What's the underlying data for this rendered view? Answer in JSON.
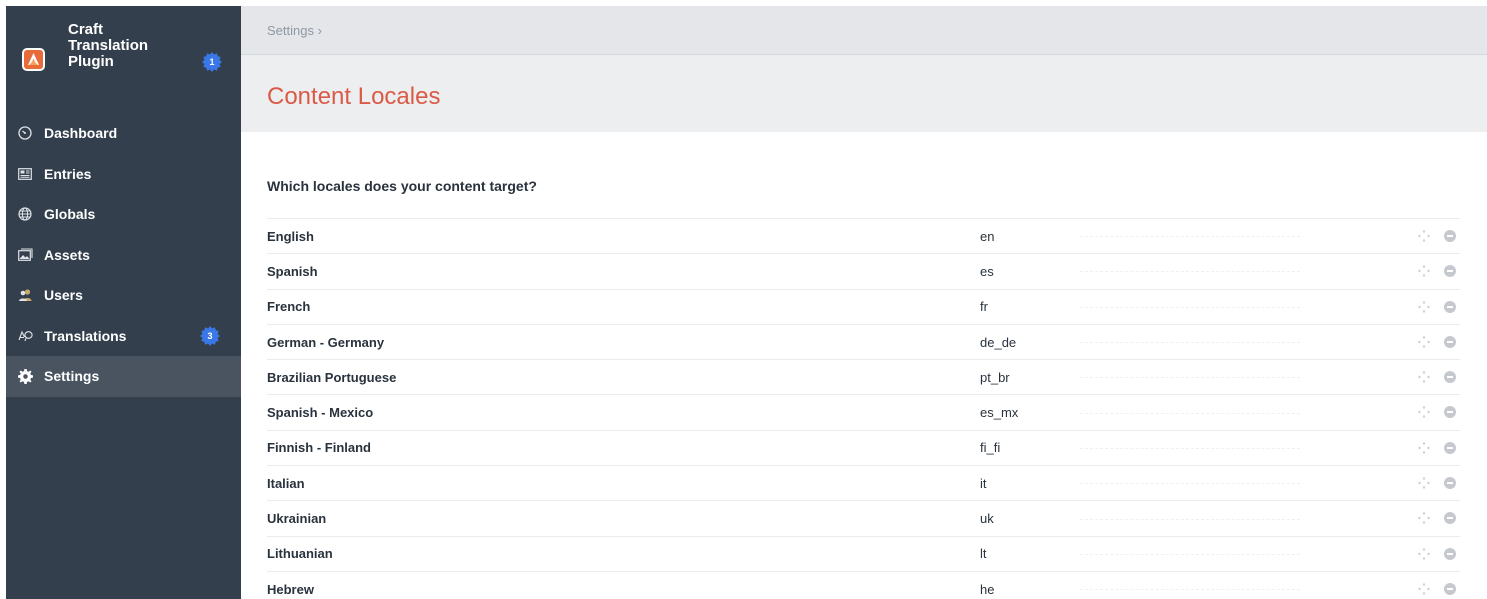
{
  "site": {
    "name": "Craft Translation Plugin",
    "badge": "1"
  },
  "nav": [
    {
      "label": "Dashboard",
      "icon": "gauge-icon",
      "badge": null,
      "active": false
    },
    {
      "label": "Entries",
      "icon": "newspaper-icon",
      "badge": null,
      "active": false
    },
    {
      "label": "Globals",
      "icon": "globe-icon",
      "badge": null,
      "active": false
    },
    {
      "label": "Assets",
      "icon": "photos-icon",
      "badge": null,
      "active": false
    },
    {
      "label": "Users",
      "icon": "users-icon",
      "badge": null,
      "active": false
    },
    {
      "label": "Translations",
      "icon": "translate-icon",
      "badge": "3",
      "active": false
    },
    {
      "label": "Settings",
      "icon": "gear-icon",
      "badge": null,
      "active": true
    }
  ],
  "breadcrumb": {
    "label": "Settings",
    "separator": "›"
  },
  "page": {
    "title": "Content Locales"
  },
  "question": "Which locales does your content target?",
  "locales": [
    {
      "name": "English",
      "code": "en"
    },
    {
      "name": "Spanish",
      "code": "es"
    },
    {
      "name": "French",
      "code": "fr"
    },
    {
      "name": "German - Germany",
      "code": "de_de"
    },
    {
      "name": "Brazilian Portuguese",
      "code": "pt_br"
    },
    {
      "name": "Spanish - Mexico",
      "code": "es_mx"
    },
    {
      "name": "Finnish - Finland",
      "code": "fi_fi"
    },
    {
      "name": "Italian",
      "code": "it"
    },
    {
      "name": "Ukrainian",
      "code": "uk"
    },
    {
      "name": "Lithuanian",
      "code": "lt"
    },
    {
      "name": "Hebrew",
      "code": "he"
    }
  ],
  "colors": {
    "sidebar": "#333f4d",
    "sidebar_active": "#4a5461",
    "title": "#da5a47",
    "badge": "#3b78e7"
  }
}
